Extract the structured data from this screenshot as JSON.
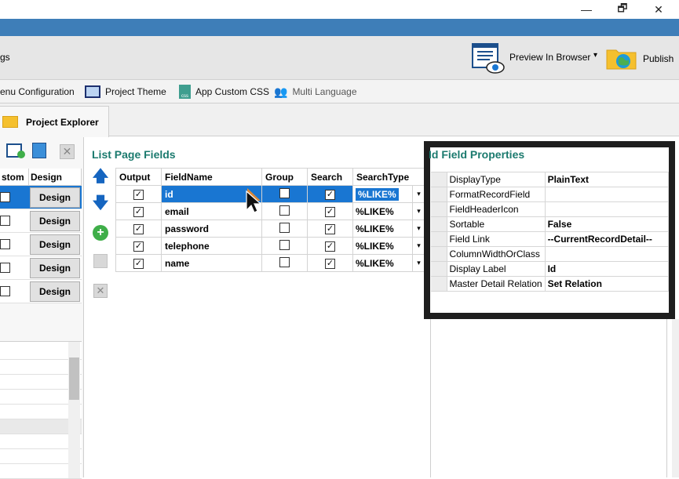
{
  "window": {
    "restore_glyph": "🗗",
    "minimize_glyph": "—",
    "close_glyph": "✕"
  },
  "ribbon": {
    "left_partial_label": "gs",
    "preview_label": "Preview In Browser",
    "preview_dropdown": "▾",
    "publish_label": "Publish"
  },
  "toolbar2": {
    "menu_config_label": "enu Configuration",
    "project_theme_label": "Project Theme",
    "app_css_label": "App Custom CSS",
    "multi_language_label": "Multi Language"
  },
  "tabs": {
    "project_explorer_label": "Project Explorer"
  },
  "left_grid": {
    "headers": [
      "stom",
      "Design"
    ],
    "design_label": "Design",
    "rows": [
      {
        "checked": false,
        "selected": true
      },
      {
        "checked": false,
        "selected": false
      },
      {
        "checked": false,
        "selected": false
      },
      {
        "checked": false,
        "selected": false
      },
      {
        "checked": false,
        "selected": false
      }
    ]
  },
  "list_page_fields": {
    "title": "List Page Fields",
    "headers": [
      "Output",
      "FieldName",
      "Group",
      "Search",
      "SearchType"
    ],
    "rows": [
      {
        "output": true,
        "field": "id",
        "group": false,
        "search": true,
        "search_type": "%LIKE%",
        "selected": true
      },
      {
        "output": true,
        "field": "email",
        "group": false,
        "search": true,
        "search_type": "%LIKE%",
        "selected": false
      },
      {
        "output": true,
        "field": "password",
        "group": false,
        "search": true,
        "search_type": "%LIKE%",
        "selected": false
      },
      {
        "output": true,
        "field": "telephone",
        "group": false,
        "search": true,
        "search_type": "%LIKE%",
        "selected": false
      },
      {
        "output": true,
        "field": "name",
        "group": false,
        "search": true,
        "search_type": "%LIKE%",
        "selected": false
      }
    ]
  },
  "field_properties": {
    "title": "Id Field Properties",
    "rows": [
      {
        "name": "DisplayType",
        "value": "PlainText"
      },
      {
        "name": "FormatRecordField",
        "value": ""
      },
      {
        "name": "FieldHeaderIcon",
        "value": ""
      },
      {
        "name": "Sortable",
        "value": "False"
      },
      {
        "name": "Field Link",
        "value": "--CurrentRecordDetail--"
      },
      {
        "name": "ColumnWidthOrClass",
        "value": ""
      },
      {
        "name": "Display Label",
        "value": "Id"
      },
      {
        "name": "Master Detail Relation",
        "value": "Set Relation"
      }
    ]
  },
  "colors": {
    "accent_blue": "#1976d2",
    "title_teal": "#1b7a6e",
    "bar_blue": "#3e7eb8"
  }
}
